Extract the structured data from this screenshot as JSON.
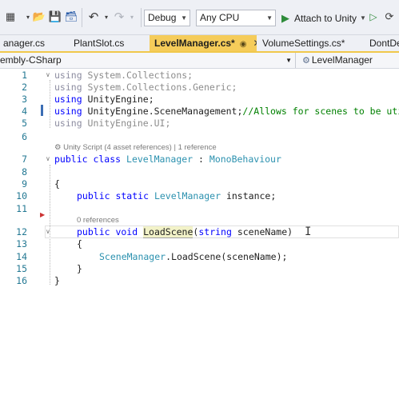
{
  "toolbar": {
    "config_value": "Debug",
    "platform_value": "Any CPU",
    "run_label": "Attach to Unity"
  },
  "tabs": [
    {
      "label": "anager.cs"
    },
    {
      "label": "PlantSlot.cs"
    },
    {
      "label": "LevelManager.cs*",
      "active": true
    },
    {
      "label": "VolumeSettings.cs*"
    },
    {
      "label": "DontDe"
    }
  ],
  "navbar": {
    "project": "embly-CSharp",
    "class": "LevelManager"
  },
  "editor": {
    "line_numbers": [
      "1",
      "2",
      "3",
      "4",
      "5",
      "6",
      "7",
      "8",
      "9",
      "10",
      "11",
      "12",
      "13",
      "14",
      "15",
      "16"
    ],
    "codelens_class": "Unity Script (4 asset references) | 1 reference",
    "codelens_method": "0 references",
    "lines": {
      "l1_kw": "using",
      "l1_ns": " System.Collections;",
      "l2_kw": "using",
      "l2_ns": " System.Collections.Generic;",
      "l3_kw": "using",
      "l3_ns": " UnityEngine;",
      "l4_kw": "using",
      "l4_ns": " UnityEngine.SceneManagement;",
      "l4_comment": "//Allows for scenes to be uti",
      "l5_kw": "using",
      "l5_ns": " UnityEngine.UI;",
      "l7_kw": "public class ",
      "l7_type": "LevelManager",
      "l7_colon": " : ",
      "l7_base": "MonoBehaviour",
      "l9": "{",
      "l10_kw": "public static ",
      "l10_type": "LevelManager",
      "l10_rest": " instance;",
      "l12_kw": "public void ",
      "l12_name": "LoadScene",
      "l12_open": "(",
      "l12_ptype": "string",
      "l12_rest": " sceneName)",
      "l13": "{",
      "l14_type": "SceneManager",
      "l14_rest": ".LoadScene(sceneName);",
      "l15": "}",
      "l16": "}"
    }
  },
  "colors": {
    "keyword": "#0000ff",
    "type": "#2b91af",
    "comment": "#008000",
    "active_tab": "#f5cc5a"
  }
}
